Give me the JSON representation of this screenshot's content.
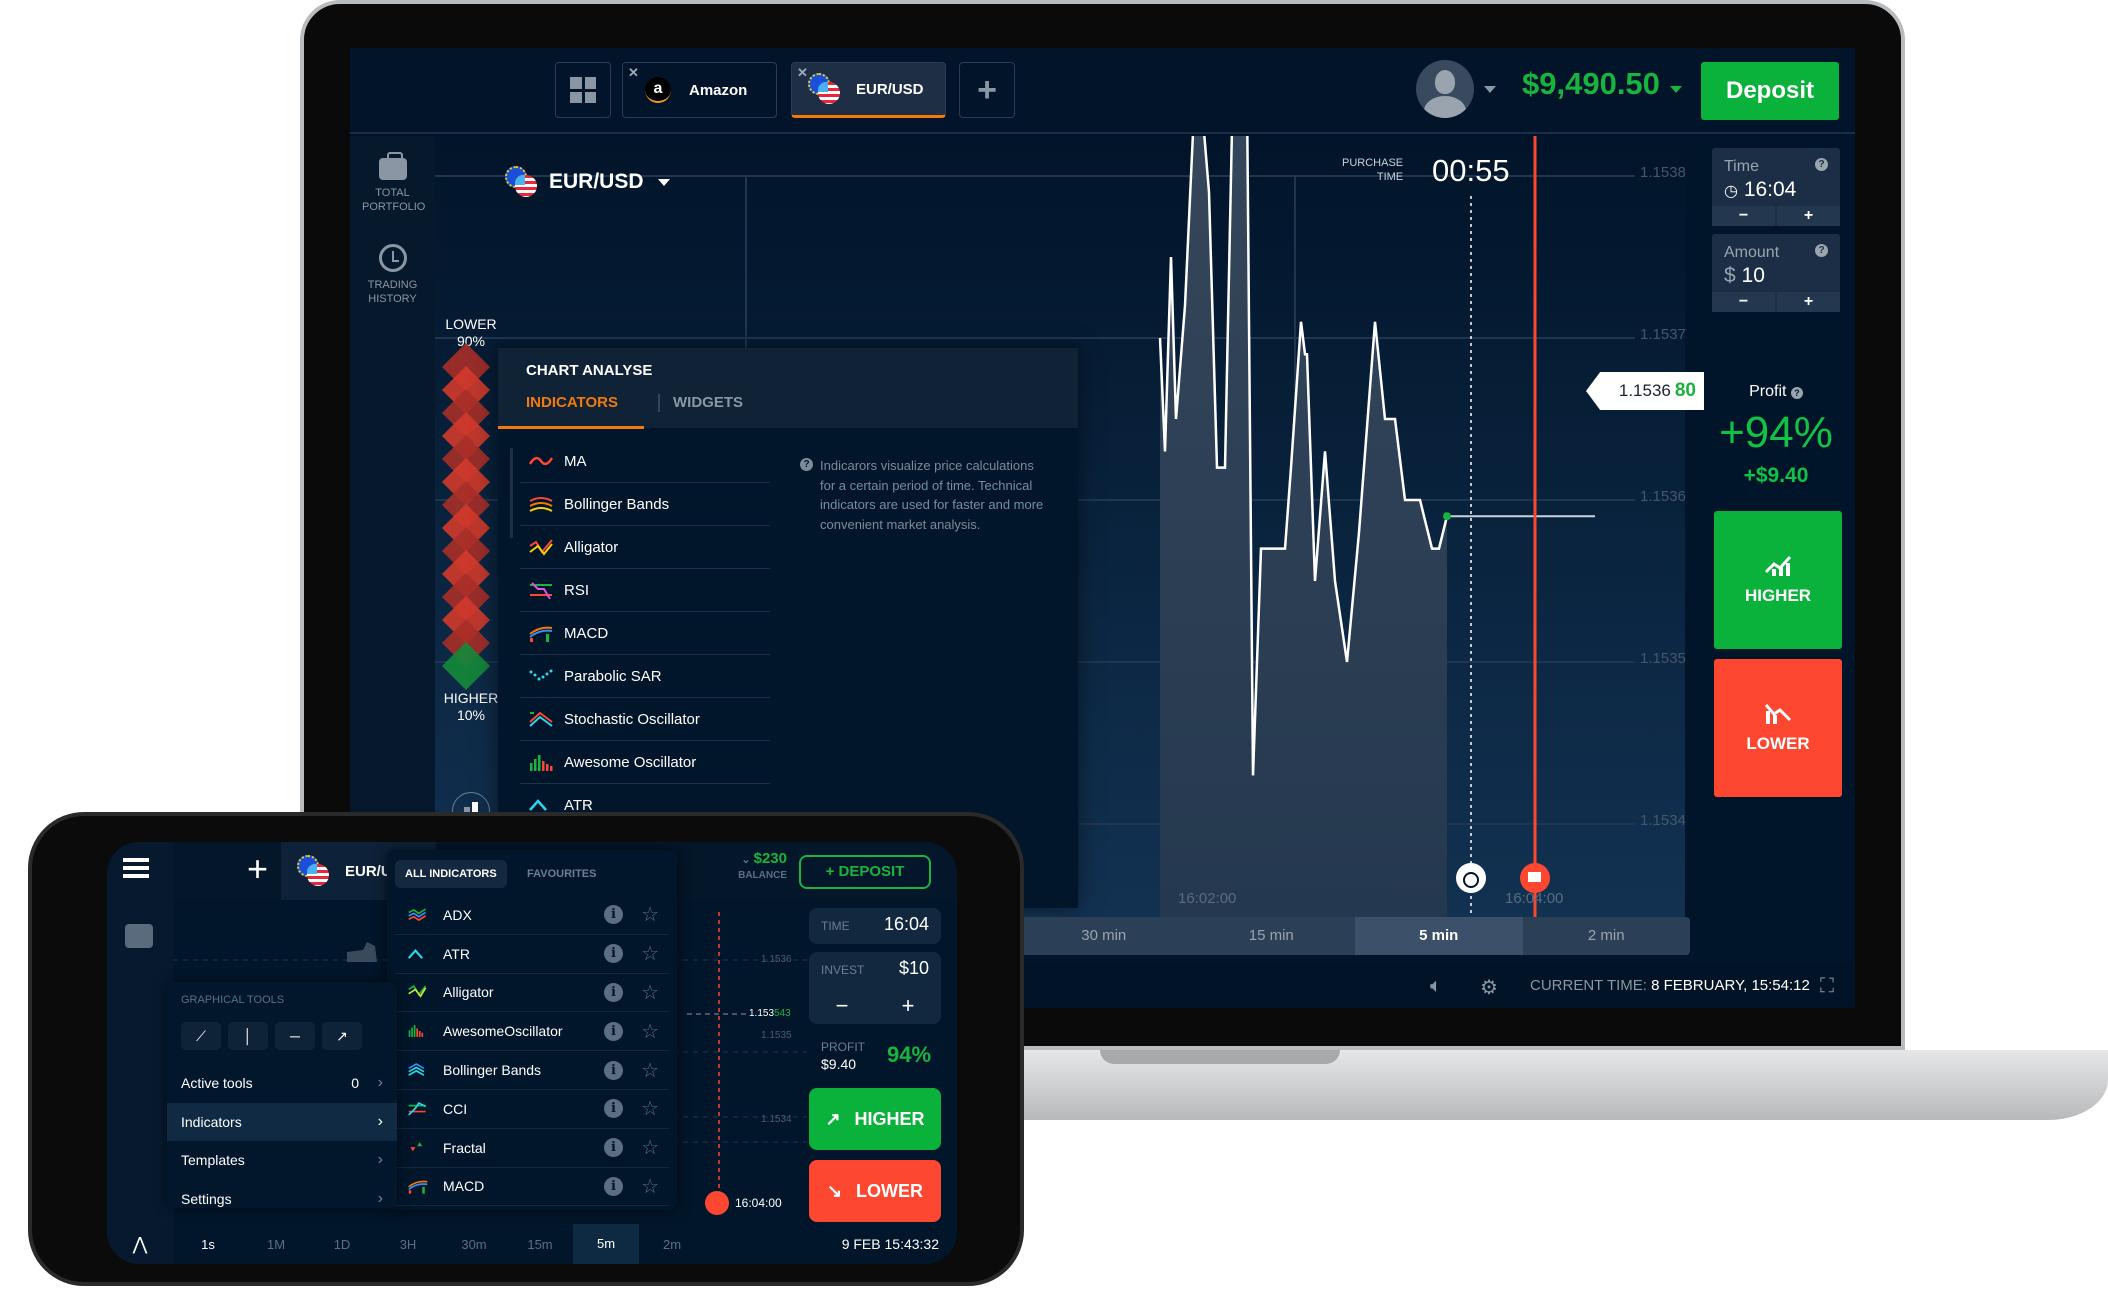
{
  "desktop": {
    "header": {
      "tabs": [
        {
          "label": "Amazon",
          "icon": "amazon-logo",
          "active": false
        },
        {
          "label": "EUR/USD",
          "icon": "eur-usd-flags",
          "active": true
        }
      ],
      "balance": "$9,490.50",
      "deposit_label": "Deposit"
    },
    "sidebar": [
      {
        "label": "TOTAL PORTFOLIO",
        "icon": "briefcase-icon"
      },
      {
        "label": "TRADING HISTORY",
        "icon": "history-icon"
      }
    ],
    "chart": {
      "asset": "EUR/USD",
      "purchase_label": "PURCHASE TIME",
      "purchase_time": "00:55",
      "price_main": "1.1536",
      "price_tail": "80",
      "y_ticks": [
        "1.1538",
        "1.1537",
        "1.1536",
        "1.1535",
        "1.1534"
      ],
      "x_ticks": [
        "16:02:00",
        "16:04:00"
      ],
      "sentiment": {
        "lower_label": "LOWER",
        "lower_pct": "90%",
        "higher_label": "HIGHER",
        "higher_pct": "10%",
        "lower_fraction": 0.9
      },
      "timeframes": [
        {
          "label": "30 min",
          "active": false
        },
        {
          "label": "15 min",
          "active": false
        },
        {
          "label": "5 min",
          "active": true
        },
        {
          "label": "2 min",
          "active": false
        }
      ]
    },
    "analyse": {
      "title": "CHART ANALYSE",
      "tabs": [
        "INDICATORS",
        "WIDGETS"
      ],
      "indicators": [
        "MA",
        "Bollinger Bands",
        "Alligator",
        "RSI",
        "MACD",
        "Parabolic SAR",
        "Stochastic Oscillator",
        "Awesome Oscillator",
        "ATR"
      ],
      "help_text": "Indicarors visualize price calculations for a certain period of time. Technical indicators are used for faster and more convenient market analysis."
    },
    "trade_panel": {
      "time_label": "Time",
      "time_value": "16:04",
      "amount_label": "Amount",
      "amount_currency": "$",
      "amount_value": "10",
      "minus": "−",
      "plus": "+",
      "profit_label": "Profit",
      "profit_pct": "+94%",
      "profit_amount": "+$9.40",
      "higher_label": "HIGHER",
      "lower_label": "LOWER"
    },
    "footer": {
      "current_time_label": "CURRENT TIME:",
      "current_time_value": "8 FEBRUARY, 15:54:12"
    },
    "colors": {
      "accent": "#f37a0a",
      "up": "#0ab23c",
      "down": "#fe4731",
      "bg": "#01152a"
    }
  },
  "mobile": {
    "asset": "EUR/USD",
    "indicator_tabs": [
      "ALL INDICATORS",
      "FAVOURITES"
    ],
    "indicators": [
      "ADX",
      "ATR",
      "Alligator",
      "AwesomeOscillator",
      "Bollinger Bands",
      "CCI",
      "Fractal",
      "MACD"
    ],
    "balance": "$230",
    "balance_label": "BALANCE",
    "deposit_label": "+ DEPOSIT",
    "tools": {
      "title": "GRAPHICAL TOOLS",
      "menu": [
        {
          "label": "Active tools",
          "count": "0",
          "active": false
        },
        {
          "label": "Indicators",
          "count": "",
          "active": true
        },
        {
          "label": "Templates",
          "count": "",
          "active": false
        },
        {
          "label": "Settings",
          "count": "",
          "active": false
        }
      ]
    },
    "time_label": "TIME",
    "time_value": "16:04",
    "invest_label": "INVEST",
    "invest_value": "$10",
    "minus": "−",
    "plus": "+",
    "profit_label": "PROFIT",
    "profit_amount": "$9.40",
    "profit_pct": "94%",
    "higher_label": "HIGHER",
    "lower_label": "LOWER",
    "y_ticks": [
      "1.1536",
      "1.1535",
      "1.1534"
    ],
    "price_main": "1.153",
    "price_tail": "543",
    "expiry": "16:04:00",
    "bottom_bar": [
      {
        "label": "1s",
        "active": false
      },
      {
        "label": "1M",
        "active": false
      },
      {
        "label": "1D",
        "active": false
      },
      {
        "label": "3H",
        "active": false
      },
      {
        "label": "30m",
        "active": false
      },
      {
        "label": "15m",
        "active": false
      },
      {
        "label": "5m",
        "active": true
      },
      {
        "label": "2m",
        "active": false
      }
    ],
    "clock": "9 FEB 15:43:32"
  }
}
